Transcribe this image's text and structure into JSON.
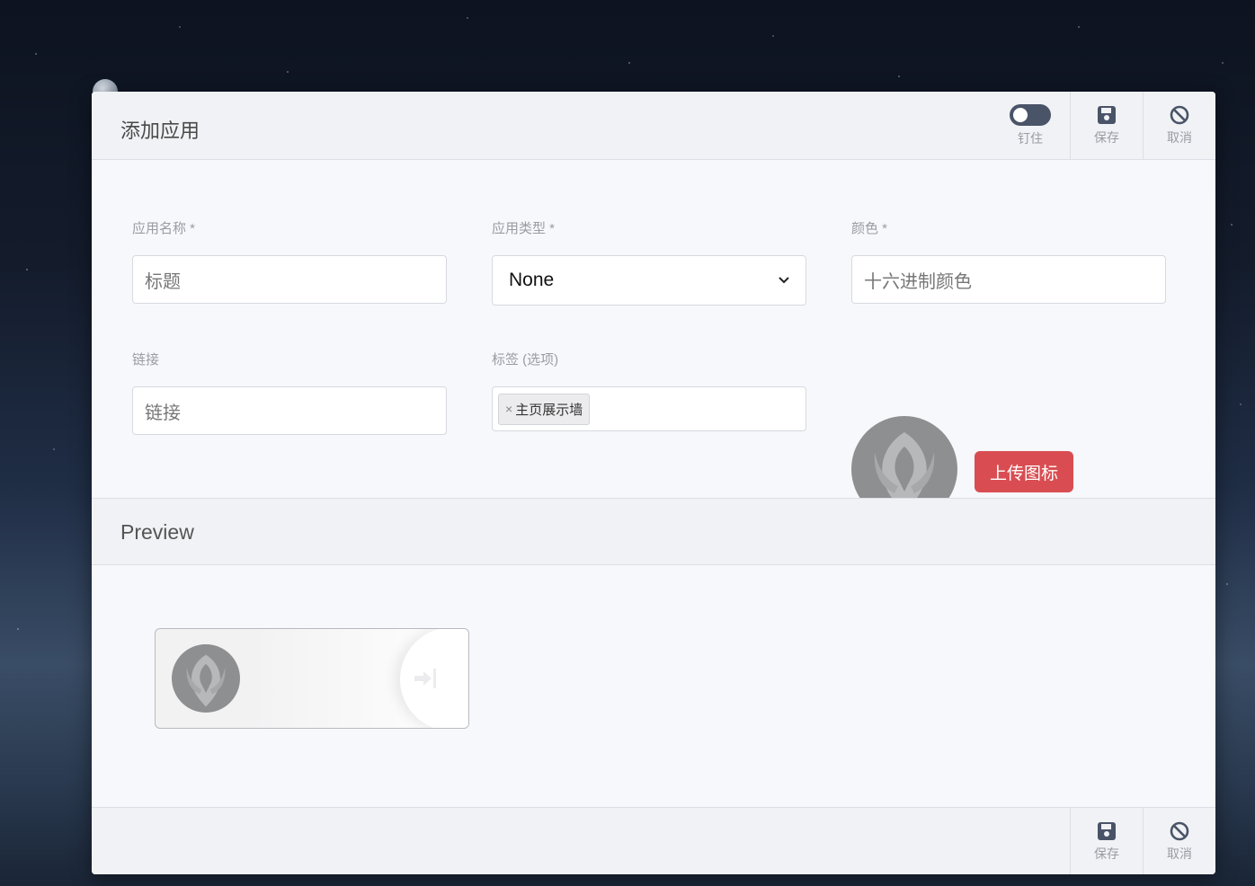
{
  "dialog": {
    "title": "添加应用",
    "pin_label": "钉住",
    "save_label": "保存",
    "cancel_label": "取消"
  },
  "form": {
    "name": {
      "label": "应用名称 *",
      "placeholder": "标题"
    },
    "type": {
      "label": "应用类型 *",
      "value": "None"
    },
    "color": {
      "label": "颜色 *",
      "placeholder": "十六进制颜色"
    },
    "link": {
      "label": "链接",
      "placeholder": "链接"
    },
    "tags": {
      "label": "标签 (选项)",
      "items": [
        "主页展示墙"
      ]
    },
    "upload_label": "上传图标"
  },
  "preview": {
    "title": "Preview"
  },
  "footer": {
    "save_label": "保存",
    "cancel_label": "取消"
  },
  "colors": {
    "upload": "#d94d52",
    "toggle": "#4a5468"
  }
}
